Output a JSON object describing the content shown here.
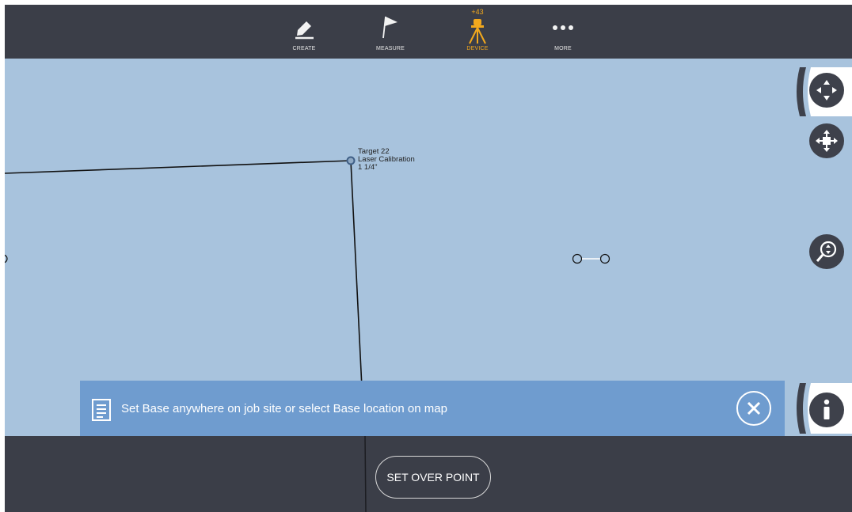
{
  "toolbar": {
    "items": [
      {
        "label": "CREATE",
        "icon": "pencil-icon"
      },
      {
        "label": "MEASURE",
        "icon": "flag-icon"
      },
      {
        "label": "DEVICE",
        "icon": "tripod-icon",
        "badge": "+43",
        "active": true
      },
      {
        "label": "MORE",
        "icon": "more-dots-icon"
      }
    ]
  },
  "map": {
    "point_label": {
      "name": "Target 22",
      "description": "Laser Calibration",
      "offset": "1 1/4\""
    }
  },
  "controls": [
    {
      "icon": "navigation-arrows-icon"
    },
    {
      "icon": "move-icon"
    },
    {
      "icon": "zoom-icon"
    },
    {
      "icon": "info-icon"
    }
  ],
  "banner": {
    "icon": "document-icon",
    "message": "Set Base anywhere on job site or select Base location on map",
    "close_icon": "close-icon"
  },
  "footer": {
    "primary_button": "SET OVER POINT"
  },
  "colors": {
    "toolbar_bg": "#3b3e48",
    "map_bg": "#a8c3dd",
    "banner_bg": "#6f9ccf",
    "accent": "#f2a81d"
  }
}
